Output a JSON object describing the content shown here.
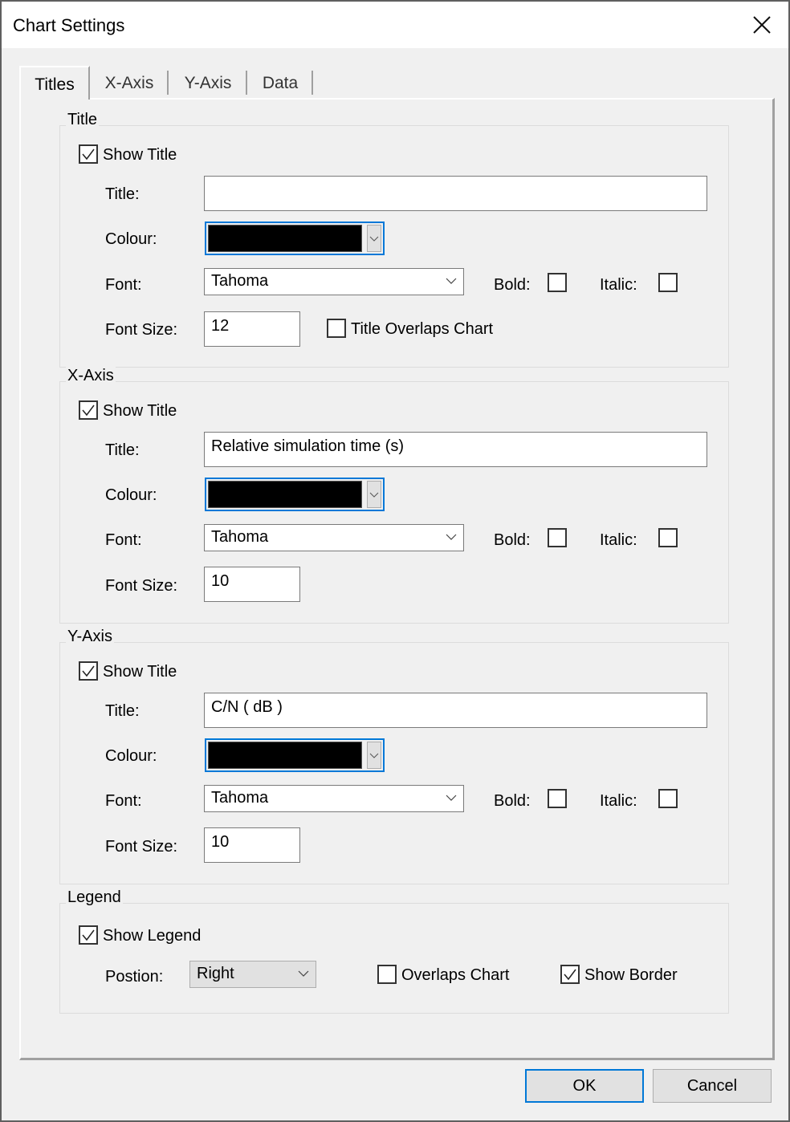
{
  "window": {
    "title": "Chart Settings",
    "close_icon": "close-icon"
  },
  "tabs": [
    {
      "label": "Titles",
      "active": true
    },
    {
      "label": "X-Axis",
      "active": false
    },
    {
      "label": "Y-Axis",
      "active": false
    },
    {
      "label": "Data",
      "active": false
    }
  ],
  "common": {
    "show_title_label": "Show Title",
    "title_label": "Title:",
    "colour_label": "Colour:",
    "font_label": "Font:",
    "bold_label": "Bold:",
    "italic_label": "Italic:",
    "font_size_label": "Font Size:"
  },
  "title_group": {
    "legend": "Title",
    "show_title": true,
    "title_value": "",
    "colour": "#000000",
    "font": "Tahoma",
    "bold": false,
    "italic": false,
    "font_size": "12",
    "overlaps_label": "Title Overlaps Chart",
    "overlaps": false
  },
  "x_axis_group": {
    "legend": "X-Axis",
    "show_title": true,
    "title_value": "Relative simulation time (s)",
    "colour": "#000000",
    "font": "Tahoma",
    "bold": false,
    "italic": false,
    "font_size": "10"
  },
  "y_axis_group": {
    "legend": "Y-Axis",
    "show_title": true,
    "title_value": "C/N ( dB )",
    "colour": "#000000",
    "font": "Tahoma",
    "bold": false,
    "italic": false,
    "font_size": "10"
  },
  "legend_group": {
    "legend": "Legend",
    "show_legend_label": "Show Legend",
    "show_legend": true,
    "position_label": "Postion:",
    "position_value": "Right",
    "overlaps_label": "Overlaps Chart",
    "overlaps": false,
    "show_border_label": "Show Border",
    "show_border": true
  },
  "buttons": {
    "ok": "OK",
    "cancel": "Cancel"
  },
  "colors": {
    "focus_accent": "#0078d7",
    "dialog_bg": "#f0f0f0"
  }
}
